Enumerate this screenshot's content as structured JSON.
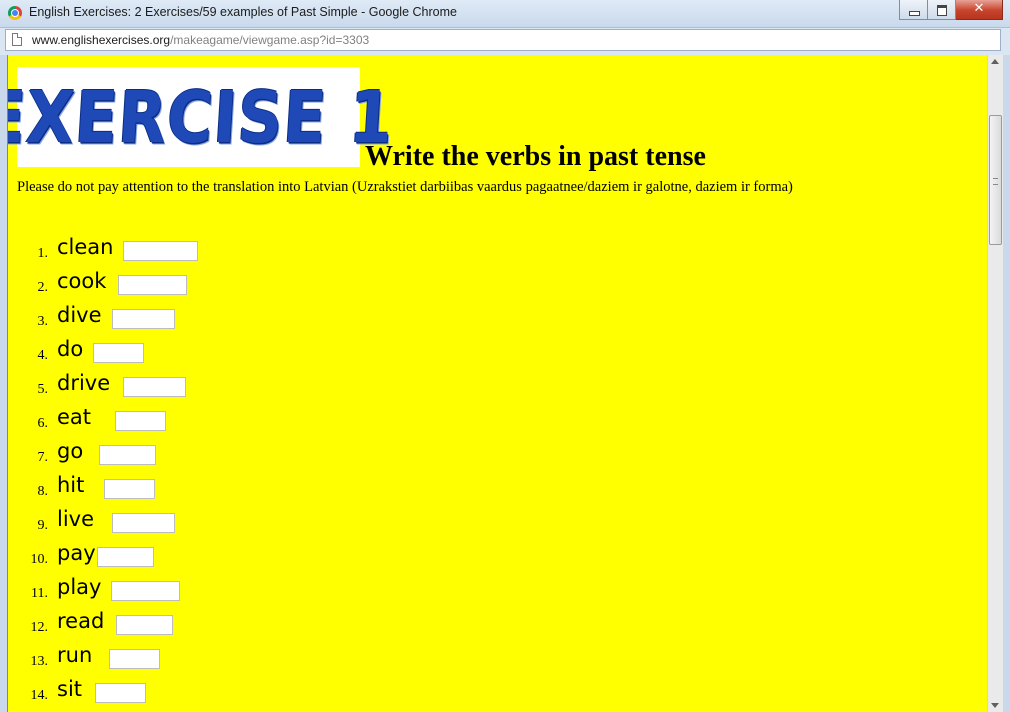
{
  "window": {
    "title": "English Exercises: 2 Exercises/59 examples of Past Simple - Google Chrome",
    "close_glyph": "✕"
  },
  "address": {
    "host": "www.englishexercises.org",
    "path": "/makeagame/viewgame.asp?id=3303"
  },
  "page": {
    "banner_text": "EXERCISE 1",
    "heading": "Write the verbs in past tense",
    "instructions": "Please do not pay attention to the translation into Latvian (Uzrakstiet darbiibas vaardus pagaatnee/daziem ir galotne, daziem ir forma)"
  },
  "exercises": [
    {
      "num": "1.",
      "word": "clean",
      "value": ""
    },
    {
      "num": "2.",
      "word": "cook",
      "value": ""
    },
    {
      "num": "3.",
      "word": "dive",
      "value": ""
    },
    {
      "num": "4.",
      "word": "do",
      "value": ""
    },
    {
      "num": "5.",
      "word": "drive",
      "value": ""
    },
    {
      "num": "6.",
      "word": "eat",
      "value": ""
    },
    {
      "num": "7.",
      "word": "go",
      "value": ""
    },
    {
      "num": "8.",
      "word": "hit",
      "value": ""
    },
    {
      "num": "9.",
      "word": "live",
      "value": ""
    },
    {
      "num": "10.",
      "word": "pay",
      "value": ""
    },
    {
      "num": "11.",
      "word": "play",
      "value": ""
    },
    {
      "num": "12.",
      "word": "read",
      "value": ""
    },
    {
      "num": "13.",
      "word": "run",
      "value": ""
    },
    {
      "num": "14.",
      "word": "sit",
      "value": ""
    }
  ]
}
